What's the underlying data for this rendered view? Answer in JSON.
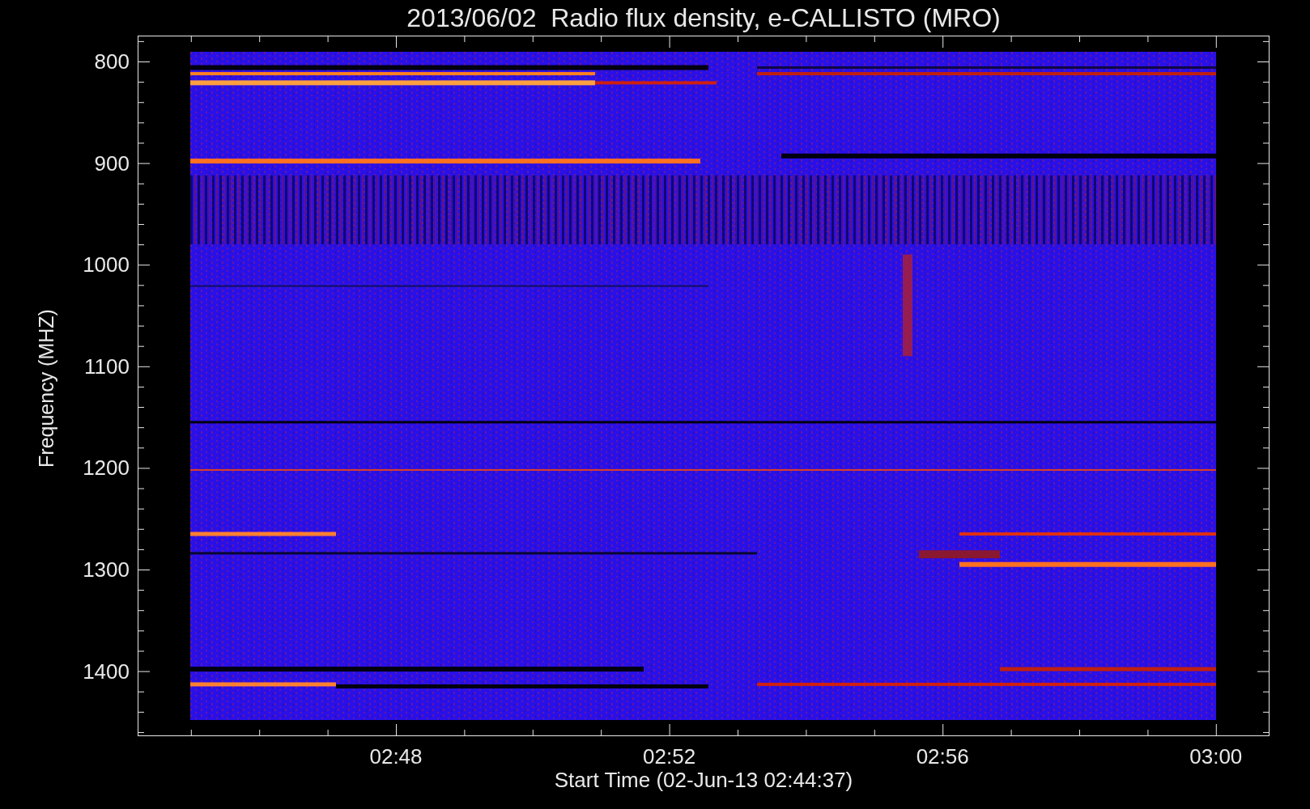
{
  "title": "2013/06/02  Radio flux density, e-CALLISTO (MRO)",
  "y_axis": {
    "label": "Frequency (MHZ)",
    "ticks": [
      "800",
      "900",
      "1000",
      "1100",
      "1200",
      "1300",
      "1400"
    ]
  },
  "x_axis": {
    "label": "Start Time (02-Jun-13 02:44:37)",
    "ticks": [
      "02:48",
      "02:52",
      "02:56",
      "03:00"
    ]
  }
}
